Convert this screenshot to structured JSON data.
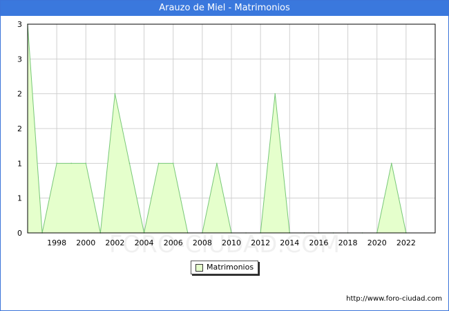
{
  "header": {
    "title": "Arauzo de Miel - Matrimonios"
  },
  "watermark": "FORO-CIUDAD.COM",
  "footer": {
    "url": "http://www.foro-ciudad.com"
  },
  "colors": {
    "title_bar": "#3a78dd",
    "area_fill": "#e5ffcc",
    "area_line": "#77c777",
    "grid": "#d0d0d0"
  },
  "chart_data": {
    "type": "area",
    "title": "Arauzo de Miel - Matrimonios",
    "xlabel": "",
    "ylabel": "",
    "x": [
      1996,
      1997,
      1998,
      1999,
      2000,
      2001,
      2002,
      2003,
      2004,
      2005,
      2006,
      2007,
      2008,
      2009,
      2010,
      2011,
      2012,
      2013,
      2014,
      2015,
      2016,
      2017,
      2018,
      2019,
      2020,
      2021,
      2022
    ],
    "series": [
      {
        "name": "Matrimonios",
        "values": [
          3,
          0,
          1,
          1,
          1,
          0,
          2,
          1,
          0,
          1,
          1,
          0,
          0,
          1,
          0,
          0,
          0,
          2,
          0,
          0,
          0,
          0,
          0,
          0,
          0,
          1,
          0
        ]
      }
    ],
    "x_tick_labels": [
      "1998",
      "2000",
      "2002",
      "2004",
      "2006",
      "2008",
      "2010",
      "2012",
      "2014",
      "2016",
      "2018",
      "2020",
      "2022"
    ],
    "y_tick_labels": [
      "0",
      "1",
      "1",
      "2",
      "2",
      "3",
      "3"
    ],
    "xlim": [
      1996,
      2024
    ],
    "ylim": [
      0,
      3
    ],
    "grid": true,
    "legend_position": "bottom"
  }
}
